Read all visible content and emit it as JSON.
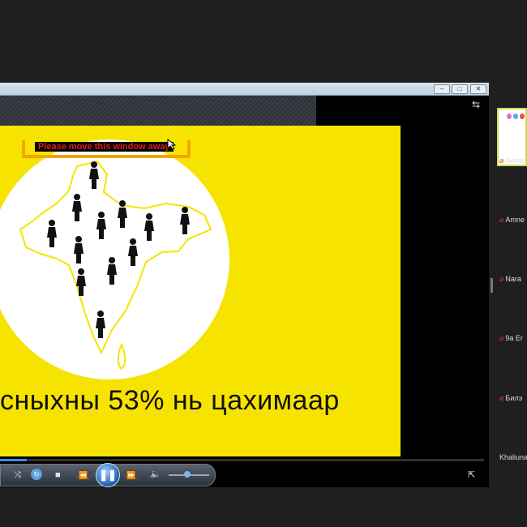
{
  "window": {
    "min_symbol": "–",
    "max_symbol": "□",
    "close_symbol": "✕"
  },
  "slide": {
    "warning": "Please move this window away",
    "caption": "сныхны 53% нь цахимаар"
  },
  "player": {
    "progress_fraction": 0.055,
    "volume_fraction": 0.45,
    "icons": [
      "shuffle-icon",
      "repeat-icon",
      "stop-icon",
      "previous-icon",
      "pause-icon",
      "next-icon",
      "volume-icon",
      "switch-to-library-icon"
    ],
    "labels": {
      "shuffle": "⤨",
      "repeat": "↻",
      "stop": "■",
      "prev": "⏪",
      "pause": "❚❚",
      "next": "⏩",
      "volume": "🔈",
      "mini": "⇱"
    }
  },
  "participants": [
    {
      "name": "Amne"
    },
    {
      "name": "Amne"
    },
    {
      "name": "Nara"
    },
    {
      "name": "9a Er"
    },
    {
      "name": "Билэ"
    },
    {
      "name": "Khaliuna"
    }
  ],
  "colors": {
    "slide_background": "#f6e400",
    "warning_text": "#e21f1f",
    "warning_border": "#f2a500",
    "accent": "#3a8ee6"
  }
}
